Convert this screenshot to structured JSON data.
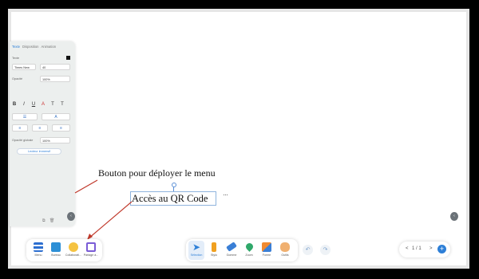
{
  "panel": {
    "tabs": [
      "Texte",
      "Disposition",
      "Animation"
    ],
    "text_label": "Texte",
    "font_name": "Times New",
    "font_size": "40",
    "opacity_label": "Opacité",
    "opacity_value": "100%",
    "format_buttons": [
      "B",
      "I",
      "U",
      "A",
      "T",
      "T"
    ],
    "fill_opacity_label": "Opacité globale",
    "fill_opacity_value": "100%",
    "more_button": "Lecteur immersif"
  },
  "annotations": {
    "menu_note": "Bouton pour déployer le menu",
    "qr_note": "Accès au QR Code",
    "more_dots": "···"
  },
  "left_toolbar": [
    {
      "label": "Menu",
      "icon": "menu-icon",
      "color": "#2d6fd0"
    },
    {
      "label": "Bureau",
      "icon": "desktop-icon",
      "color": "#2d8fd6"
    },
    {
      "label": "Collaborati...",
      "icon": "smiley-icon",
      "color": "#f5c342"
    },
    {
      "label": "Partage à...",
      "icon": "share-qr-icon",
      "color": "#7a5cd6"
    }
  ],
  "center_toolbar": [
    {
      "label": "Sélection",
      "icon": "cursor-icon",
      "color": "#2d7fd7"
    },
    {
      "label": "Stylo",
      "icon": "pen-icon",
      "color": "#f0a020"
    },
    {
      "label": "Gomme",
      "icon": "eraser-icon",
      "color": "#3a7fd6"
    },
    {
      "label": "Zoom",
      "icon": "location-icon",
      "color": "#2fa86a"
    },
    {
      "label": "Forme",
      "icon": "shapes-icon",
      "color": "#f08a30"
    },
    {
      "label": "Outils",
      "icon": "toolbox-icon",
      "color": "#f0b070"
    }
  ],
  "undo_icon": "↶",
  "redo_icon": "↷",
  "pager": {
    "prev": "<",
    "text": "1 / 1",
    "next": ">",
    "add": "+"
  },
  "collapse_glyph": "‹",
  "right_glyph": "‹"
}
